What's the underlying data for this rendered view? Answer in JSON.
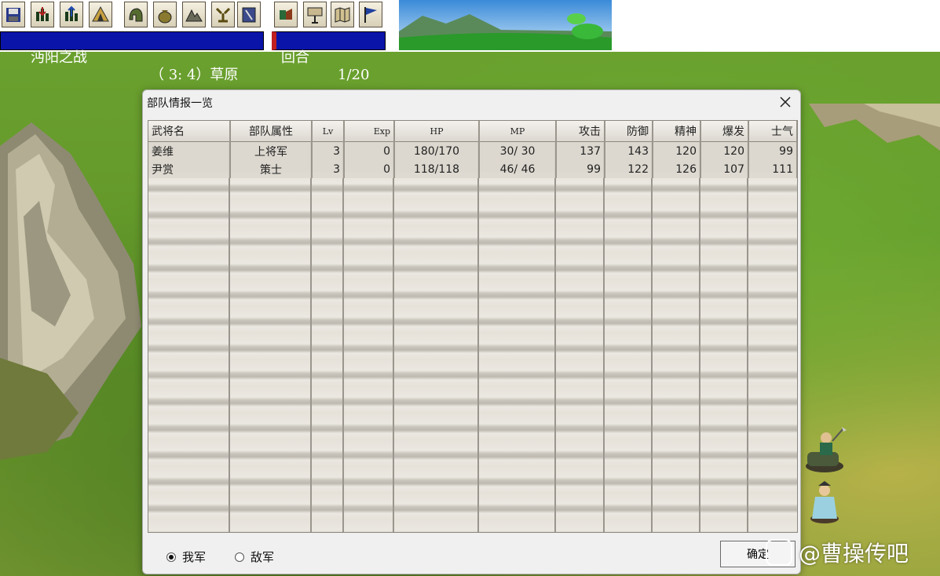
{
  "topbar": {
    "battle_name": "沔阳之战",
    "position_terrain": "（ 3: 4）草原",
    "turn_label": "回合",
    "turn_value": "1/20",
    "tools_group1": [
      "save-icon",
      "load-icon",
      "unit-out-icon",
      "camp-icon"
    ],
    "tools_group2": [
      "helmet-icon",
      "money-bag-icon",
      "mountain-icon",
      "tactic-icon",
      "book-icon"
    ],
    "tools_group3": [
      "army-icon",
      "terrain-icon",
      "map-icon",
      "flag-icon"
    ]
  },
  "dialog": {
    "title": "部队情报一览",
    "columns": [
      "武将名",
      "部队属性",
      "Lv",
      "Exp",
      "HP",
      "MP",
      "攻击",
      "防御",
      "精神",
      "爆发",
      "士气"
    ],
    "rows": [
      {
        "name": "姜维",
        "class": "上将军",
        "lv": "3",
        "exp": "0",
        "hp": "180/170",
        "mp": "30/ 30",
        "atk": "137",
        "def": "143",
        "spirit": "120",
        "burst": "120",
        "morale": "99"
      },
      {
        "name": "尹赏",
        "class": "策士",
        "lv": "3",
        "exp": "0",
        "hp": "118/118",
        "mp": "46/ 46",
        "atk": "99",
        "def": "122",
        "spirit": "126",
        "burst": "107",
        "morale": "111"
      }
    ],
    "radio_ours": "我军",
    "radio_enemy": "敌军",
    "confirm_label": "确定"
  },
  "watermark": "@曹操传吧",
  "colors": {
    "infobar_bg": "#0a14a8",
    "grass": "#6aa02e",
    "dialog_bg": "#f0f0f0"
  }
}
